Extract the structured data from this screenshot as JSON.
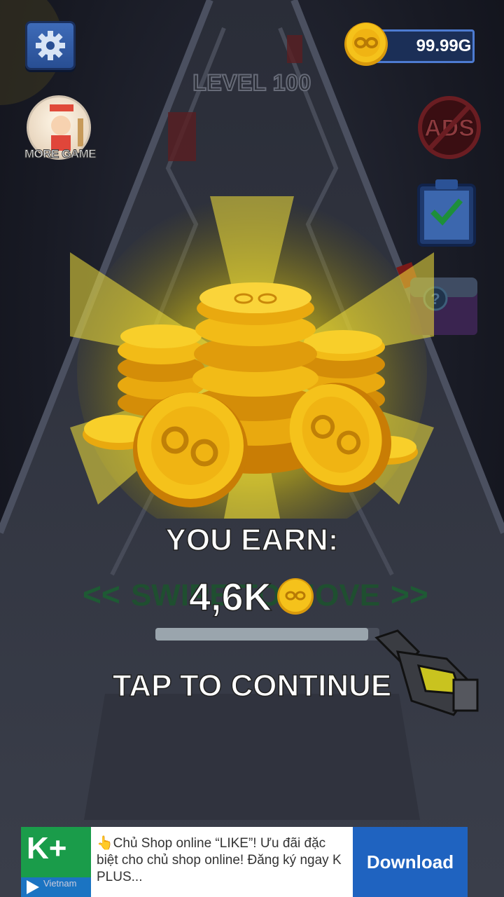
{
  "hud": {
    "level_label": "LEVEL 100",
    "coin_balance": "99.99G",
    "more_game_label": "MORE GAME",
    "ads_icon_text": "ADS"
  },
  "reward": {
    "earn_label": "YOU EARN:",
    "amount": "4,6K",
    "swipe_left": "<<",
    "swipe_text": "SWIPE TO MOVE",
    "swipe_right": ">>",
    "progress": 0.95,
    "tap_label": "TAP TO CONTINUE"
  },
  "ad": {
    "logo_text": "K+",
    "logo_sub": "Vietnam",
    "body": "👆Chủ Shop online “LIKE”! Ưu đãi đặc biệt cho chủ shop online! Đăng ký ngay K PLUS...",
    "cta": "Download"
  },
  "colors": {
    "coin_gold": "#f5c21b",
    "hud_blue": "#284e93",
    "ad_green": "#1a9c4a",
    "ad_blue": "#1f63c0",
    "swipe_green": "#1f6b3a"
  },
  "icons": [
    "gear-icon",
    "coin-icon",
    "no-ads-icon",
    "checklist-icon",
    "mystery-box-icon",
    "hand-pointer-icon",
    "play-icon"
  ]
}
